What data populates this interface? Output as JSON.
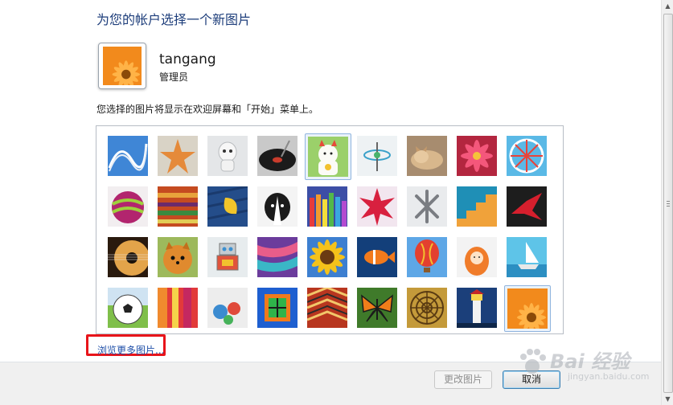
{
  "header": {
    "title": "为您的帐户选择一个新图片"
  },
  "account": {
    "username": "tangang",
    "role": "管理员",
    "current_picture": "orange-gerbera-daisy"
  },
  "hint": "您选择的图片将显示在欢迎屏幕和「开始」菜单上。",
  "pictures": [
    "roller-coaster",
    "starfish",
    "robot-dog",
    "turntable",
    "lucky-cat",
    "spinning-top",
    "sleeping-kitten",
    "pink-flower",
    "pinwheel",
    "striped-ball",
    "fabric-rolls",
    "yellow-leaf",
    "border-collie",
    "crayons",
    "red-star-lantern",
    "jacks",
    "sunlit-stairs",
    "origami-crane",
    "guitar",
    "pomeranian",
    "toy-robot",
    "colorful-scarves",
    "sunflower",
    "clownfish",
    "hot-air-balloon",
    "matryoshka",
    "sailboat",
    "soccer-ball",
    "striped-fabric",
    "marbles",
    "green-window",
    "woven-pattern",
    "monarch-butterfly",
    "spiral-dome",
    "lighthouse",
    "orange-gerbera-daisy"
  ],
  "selected_index": 35,
  "links": {
    "browse": "浏览更多图片..."
  },
  "buttons": {
    "change": "更改图片",
    "cancel": "取消"
  },
  "watermark": {
    "brand": "Bai 经验",
    "url": "jingyan.baidu.com"
  }
}
